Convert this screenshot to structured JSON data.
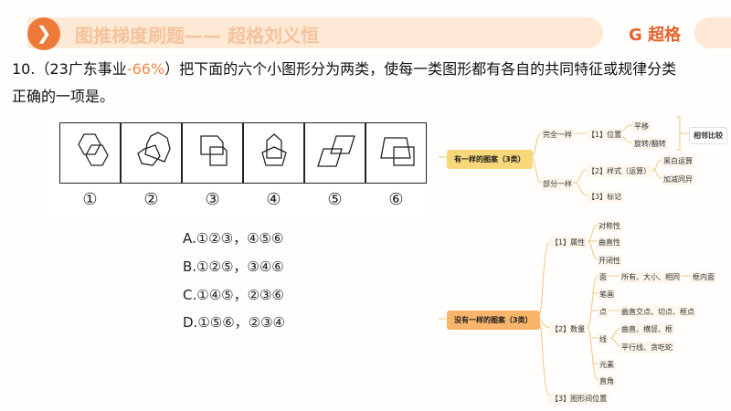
{
  "header": {
    "title": "图推梯度刷题—— 超格刘义恒",
    "logo": "超格",
    "logo_icon": "G"
  },
  "question": {
    "line1_prefix": "10.（23广东事业",
    "line1_pct": "-66%",
    "line1_suffix": "）把下面的六个小图形分为两类，使每一类图形都有各自的共同特征或规律分类",
    "line2": "正确的一项是。"
  },
  "figures": [
    "①",
    "②",
    "③",
    "④",
    "⑤",
    "⑥"
  ],
  "options": [
    "A.①②③，④⑤⑥",
    "B.①②⑤，③④⑥",
    "C.①④⑤，②③⑥",
    "D.①⑤⑥，②③④"
  ],
  "mindmap": {
    "root1": "有一样的图案（3类）",
    "a1": "完全一样",
    "a2": "部分一样",
    "b1": "【1】位置",
    "c1": "平移",
    "c2": "旋转/翻转",
    "c3": "相邻比较",
    "b2": "【2】样式（运算）",
    "c4": "黑白运算",
    "c5": "加减同异",
    "b3": "【3】标记",
    "root2": "没有一样的图案（3类）",
    "d1": "【1】属性",
    "e1": "对称性",
    "e2": "曲直性",
    "e3": "开闭性",
    "d2": "【2】数量",
    "f1": "面",
    "f1a": "所有、大小、相同",
    "f1b": "框内面",
    "f2": "笔画",
    "f3": "点",
    "f3a": "曲直交点、切点、框点",
    "f4": "线",
    "f4a": "曲直、横竖、框",
    "f4b": "平行线、贪吃蛇",
    "f5": "元素",
    "f6": "直角",
    "d3": "【3】图形间位置"
  },
  "colors": {
    "accent": "#ee7a3a",
    "root1": "#f7d77a",
    "root2": "#f9b56a"
  }
}
